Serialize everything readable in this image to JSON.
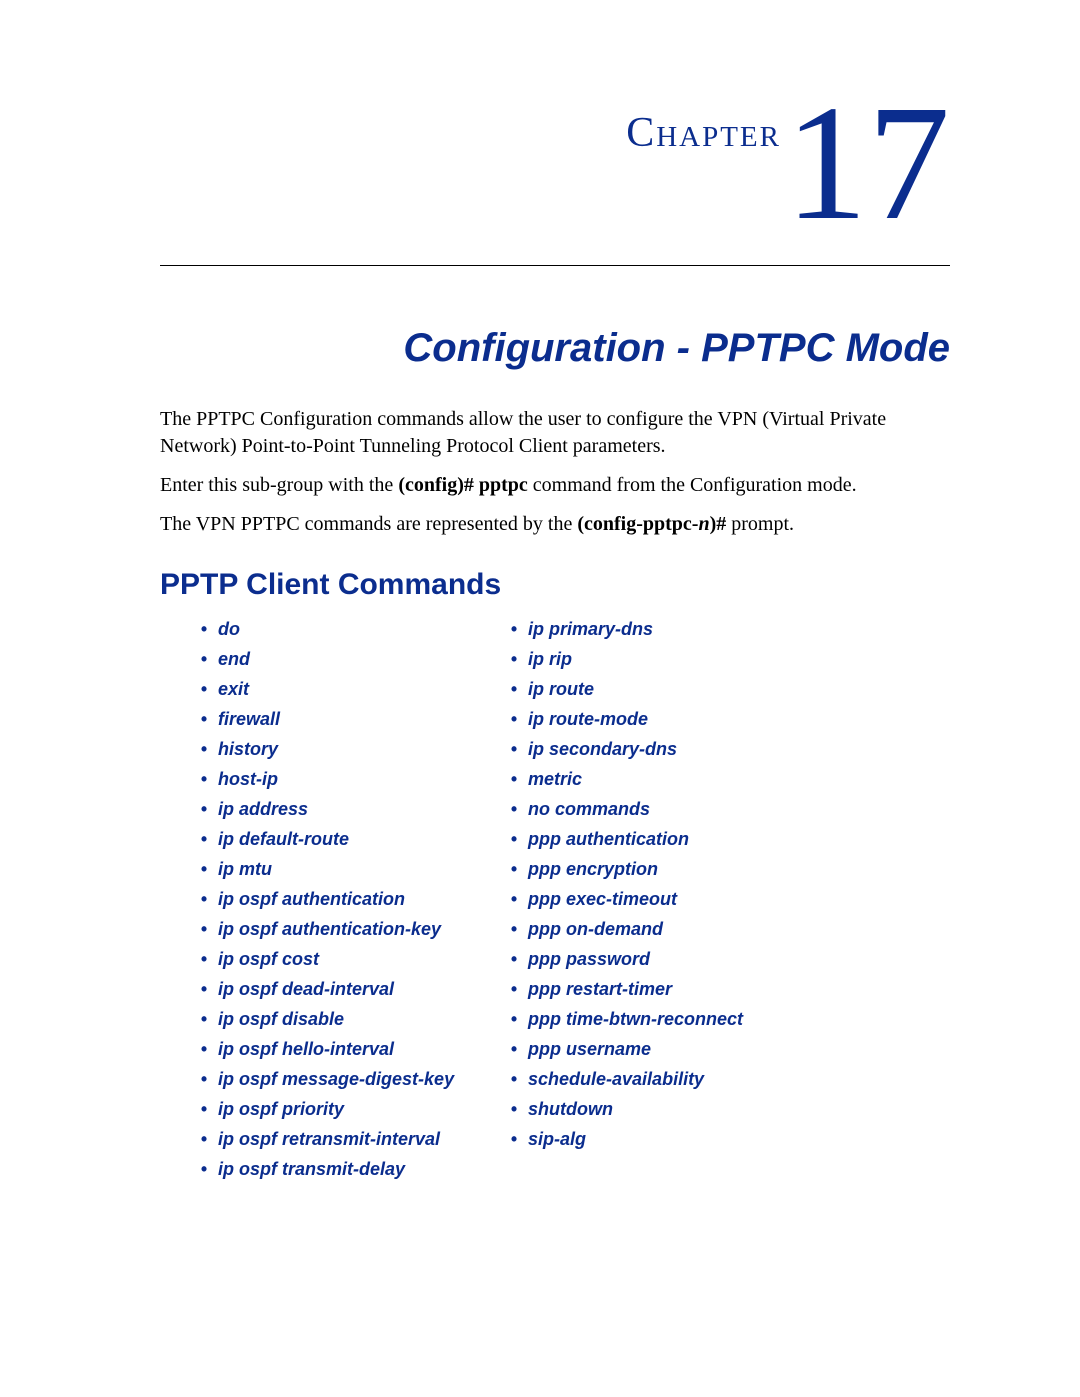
{
  "chapter": {
    "label": "Chapter",
    "number": "17"
  },
  "title": "Configuration - PPTPC Mode",
  "paragraphs": {
    "p1": "The PPTPC Configuration commands allow the user to configure the VPN (Virtual Private Network) Point-to-Point Tunneling Protocol Client parameters.",
    "p2_a": "Enter this sub-group with the ",
    "p2_cmd": "(config)# pptpc",
    "p2_b": " command from the Configuration mode.",
    "p3_a": "The VPN PPTPC commands are represented by the ",
    "p3_cmd_bold": "(config-pptpc-",
    "p3_cmd_i": "n",
    "p3_cmd_bold2": ")#",
    "p3_b": " prompt."
  },
  "section_heading": "PPTP Client Commands",
  "commands": {
    "left": [
      "do",
      "end",
      "exit",
      "firewall",
      "history",
      "host-ip",
      "ip address",
      "ip default-route",
      "ip mtu",
      "ip ospf authentication",
      "ip ospf authentication-key",
      "ip ospf cost",
      "ip ospf dead-interval",
      "ip ospf disable",
      "ip ospf hello-interval",
      "ip ospf message-digest-key",
      "ip ospf priority",
      "ip ospf retransmit-interval",
      "ip ospf transmit-delay"
    ],
    "right": [
      "ip primary-dns",
      "ip rip",
      "ip route",
      "ip route-mode",
      "ip secondary-dns",
      "metric",
      "no commands",
      "ppp authentication",
      "ppp encryption",
      "ppp exec-timeout",
      "ppp on-demand",
      "ppp password",
      "ppp restart-timer",
      "ppp time-btwn-reconnect",
      "ppp username",
      "schedule-availability",
      "shutdown",
      "sip-alg"
    ]
  }
}
